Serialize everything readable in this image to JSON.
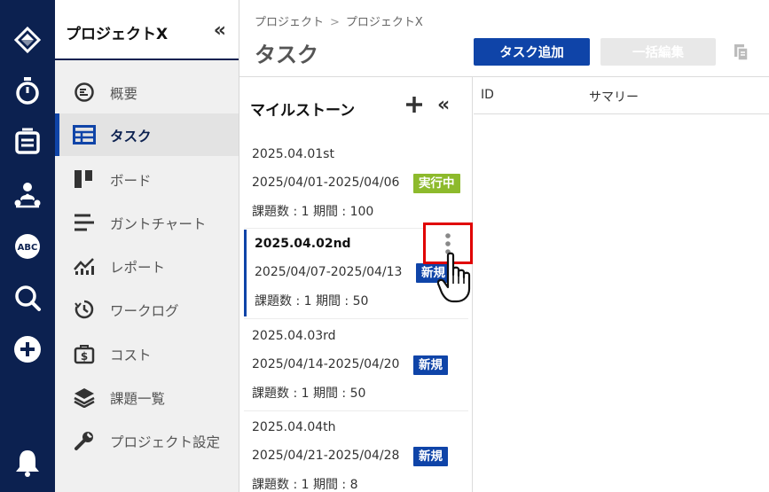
{
  "rail": {
    "icons": [
      "logo-icon",
      "stopwatch-icon",
      "inbox-icon",
      "team-icon",
      "abc-icon",
      "search-icon",
      "add-circle-icon",
      "bell-icon"
    ]
  },
  "sidebar": {
    "project_name": "プロジェクトX",
    "collapse_glyph": "«",
    "items": [
      {
        "label": "概要",
        "icon": "overview-icon"
      },
      {
        "label": "タスク",
        "icon": "table-icon"
      },
      {
        "label": "ボード",
        "icon": "board-icon"
      },
      {
        "label": "ガントチャート",
        "icon": "gantt-icon"
      },
      {
        "label": "レポート",
        "icon": "report-icon"
      },
      {
        "label": "ワークログ",
        "icon": "worklog-icon"
      },
      {
        "label": "コスト",
        "icon": "cost-icon"
      },
      {
        "label": "課題一覧",
        "icon": "layers-icon"
      },
      {
        "label": "プロジェクト設定",
        "icon": "wrench-icon"
      }
    ],
    "active_index": 1
  },
  "header": {
    "breadcrumb": [
      "プロジェクト",
      "プロジェクトX"
    ],
    "breadcrumb_sep": ">",
    "title": "タスク",
    "add_button": "タスク追加",
    "bulk_button": "一括編集"
  },
  "milestones": {
    "title": "マイルストーン",
    "collapse_glyph": "«",
    "items": [
      {
        "name": "2025.04.01st",
        "dates": "2025/04/01-2025/04/06",
        "count": "課題数 : 1 期間 : 100",
        "badge": "実行中"
      },
      {
        "name": "2025.04.02nd",
        "dates": "2025/04/07-2025/04/13",
        "count": "課題数 : 1 期間 : 50",
        "badge": "新規"
      },
      {
        "name": "2025.04.03rd",
        "dates": "2025/04/14-2025/04/20",
        "count": "課題数 : 1 期間 : 50",
        "badge": "新規"
      },
      {
        "name": "2025.04.04th",
        "dates": "2025/04/21-2025/04/28",
        "count": "課題数 : 1 期間 : 8",
        "badge": "新規"
      }
    ]
  },
  "table": {
    "columns": [
      "ID",
      "サマリー"
    ]
  },
  "colors": {
    "rail_bg": "#0c2150",
    "primary": "#0f44a8",
    "running_badge": "#8dba2c",
    "highlight_box": "#e00000"
  }
}
